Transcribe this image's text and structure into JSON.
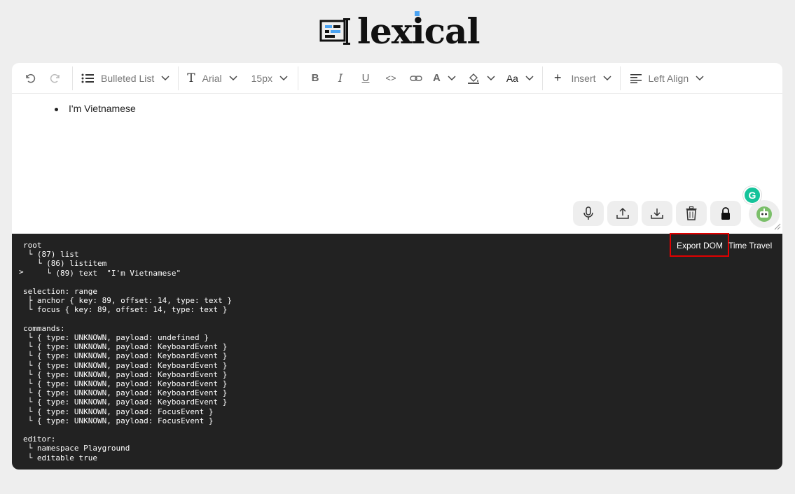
{
  "logo": {
    "text": "lexical"
  },
  "toolbar": {
    "undo_icon": "undo-icon",
    "redo_icon": "redo-icon",
    "block_type": "Bulleted List",
    "font_family": "Arial",
    "font_size": "15px",
    "bold": "B",
    "italic": "I",
    "underline": "U",
    "code_icon": "<>",
    "font_color": "A",
    "text_format": "Aa",
    "insert": "Insert",
    "align": "Left Align"
  },
  "content": {
    "list_items": [
      "I'm Vietnamese"
    ]
  },
  "grammarly": {
    "letter": "G"
  },
  "tree_view": {
    "text": "root\n └ (87) list\n   └ (86) listitem\n     └ (89) text  \"I'm Vietnamese\"\n\nselection: range\n ├ anchor { key: 89, offset: 14, type: text }\n └ focus { key: 89, offset: 14, type: text }\n\ncommands:\n └ { type: UNKNOWN, payload: undefined }\n └ { type: UNKNOWN, payload: KeyboardEvent }\n └ { type: UNKNOWN, payload: KeyboardEvent }\n └ { type: UNKNOWN, payload: KeyboardEvent }\n └ { type: UNKNOWN, payload: KeyboardEvent }\n └ { type: UNKNOWN, payload: KeyboardEvent }\n └ { type: UNKNOWN, payload: KeyboardEvent }\n └ { type: UNKNOWN, payload: KeyboardEvent }\n └ { type: UNKNOWN, payload: FocusEvent }\n └ { type: UNKNOWN, payload: FocusEvent }\n\neditor:\n └ namespace Playground\n └ editable true",
    "caret": ">",
    "export_dom": "Export DOM",
    "time_travel": "Time Travel"
  },
  "colors": {
    "highlight_box": "#e00000",
    "tree_bg": "#222222",
    "page_bg": "#eeeeee"
  }
}
